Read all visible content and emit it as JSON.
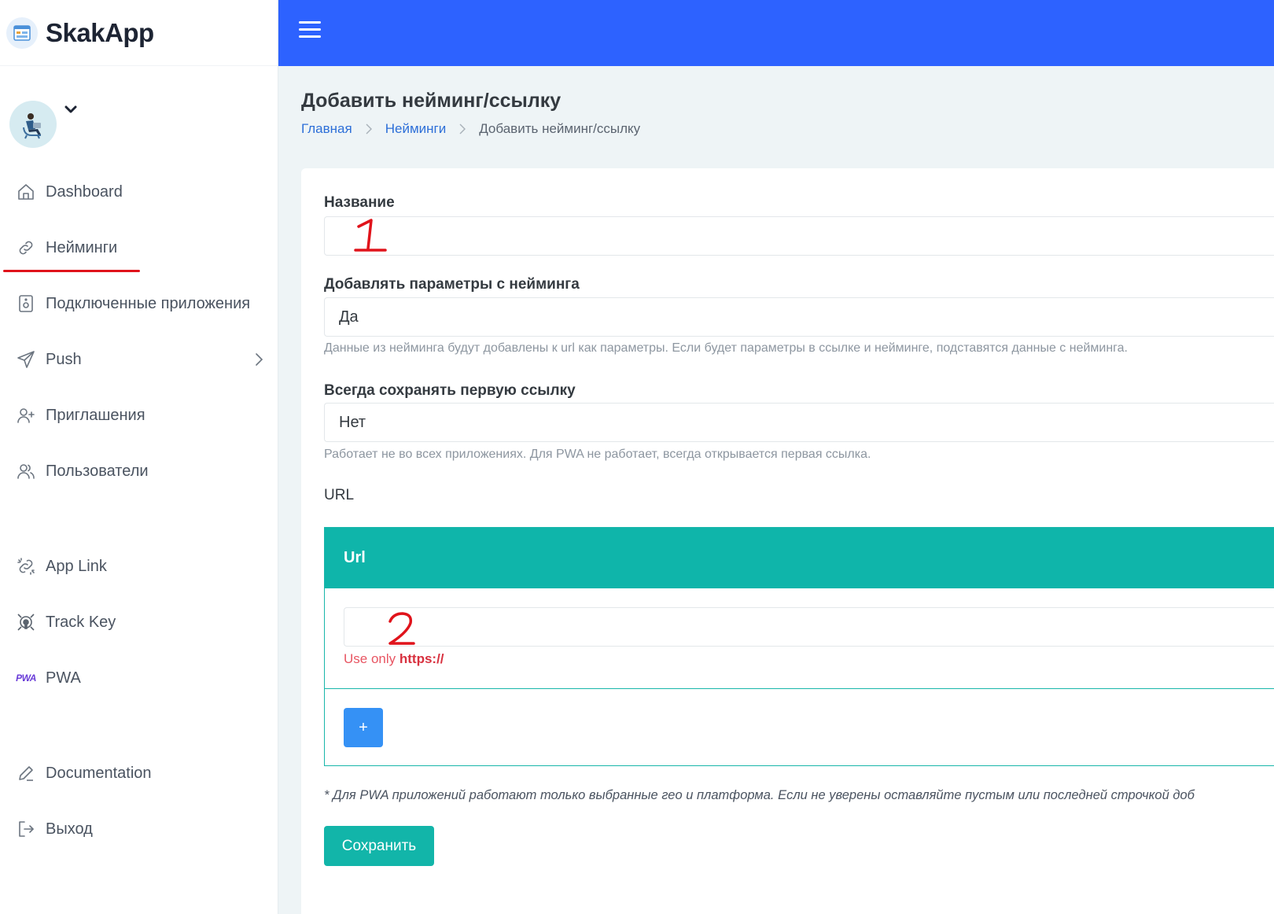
{
  "brand": {
    "name": "SkakApp"
  },
  "colors": {
    "topbar": "#2d62ff",
    "teal": "#0fb5aa",
    "link": "#2d6fd8",
    "add_button": "#3591f5",
    "annotation": "#e0131b"
  },
  "sidebar": {
    "items": [
      {
        "label": "Dashboard",
        "icon": "home-icon"
      },
      {
        "label": "Нейминги",
        "icon": "link-icon"
      },
      {
        "label": "Подключенные приложения",
        "icon": "app-device-icon"
      },
      {
        "label": "Push",
        "icon": "send-icon"
      },
      {
        "label": "Приглашения",
        "icon": "user-plus-icon"
      },
      {
        "label": "Пользователи",
        "icon": "users-icon"
      },
      {
        "label": "App Link",
        "icon": "broken-link-icon"
      },
      {
        "label": "Track Key",
        "icon": "target-key-icon"
      },
      {
        "label": "PWA",
        "icon": "pwa-logo-icon",
        "icon_text": "PWA"
      },
      {
        "label": "Documentation",
        "icon": "pen-icon"
      },
      {
        "label": "Выход",
        "icon": "logout-icon"
      }
    ]
  },
  "header": {
    "title": "Добавить нейминг/ссылку",
    "breadcrumb": [
      "Главная",
      "Нейминги",
      "Добавить нейминг/ссылку"
    ]
  },
  "form": {
    "name": {
      "label": "Название",
      "value": ""
    },
    "add_params": {
      "label": "Добавлять параметры с нейминга",
      "value": "Да",
      "help": "Данные из нейминга будут добавлены к url как параметры. Если будет параметры в ссылке и нейминге, подставятся данные с нейминга."
    },
    "keep_first": {
      "label": "Всегда сохранять первую ссылку",
      "value": "Нет",
      "help": "Работает не во всех приложениях. Для PWA не работает, всегда открывается первая ссылка."
    },
    "url_section_label": "URL",
    "url_table": {
      "header": "Url",
      "value": "",
      "hint_prefix": "Use only",
      "hint_bold": "https://",
      "add_label": "+"
    },
    "note": "* Для PWA приложений работают только выбранные гео и платформа. Если не уверены оставляйте пустым или последней строчкой доб",
    "save_label": "Сохранить"
  },
  "annotations": {
    "mark_1": "1",
    "mark_2": "2"
  }
}
